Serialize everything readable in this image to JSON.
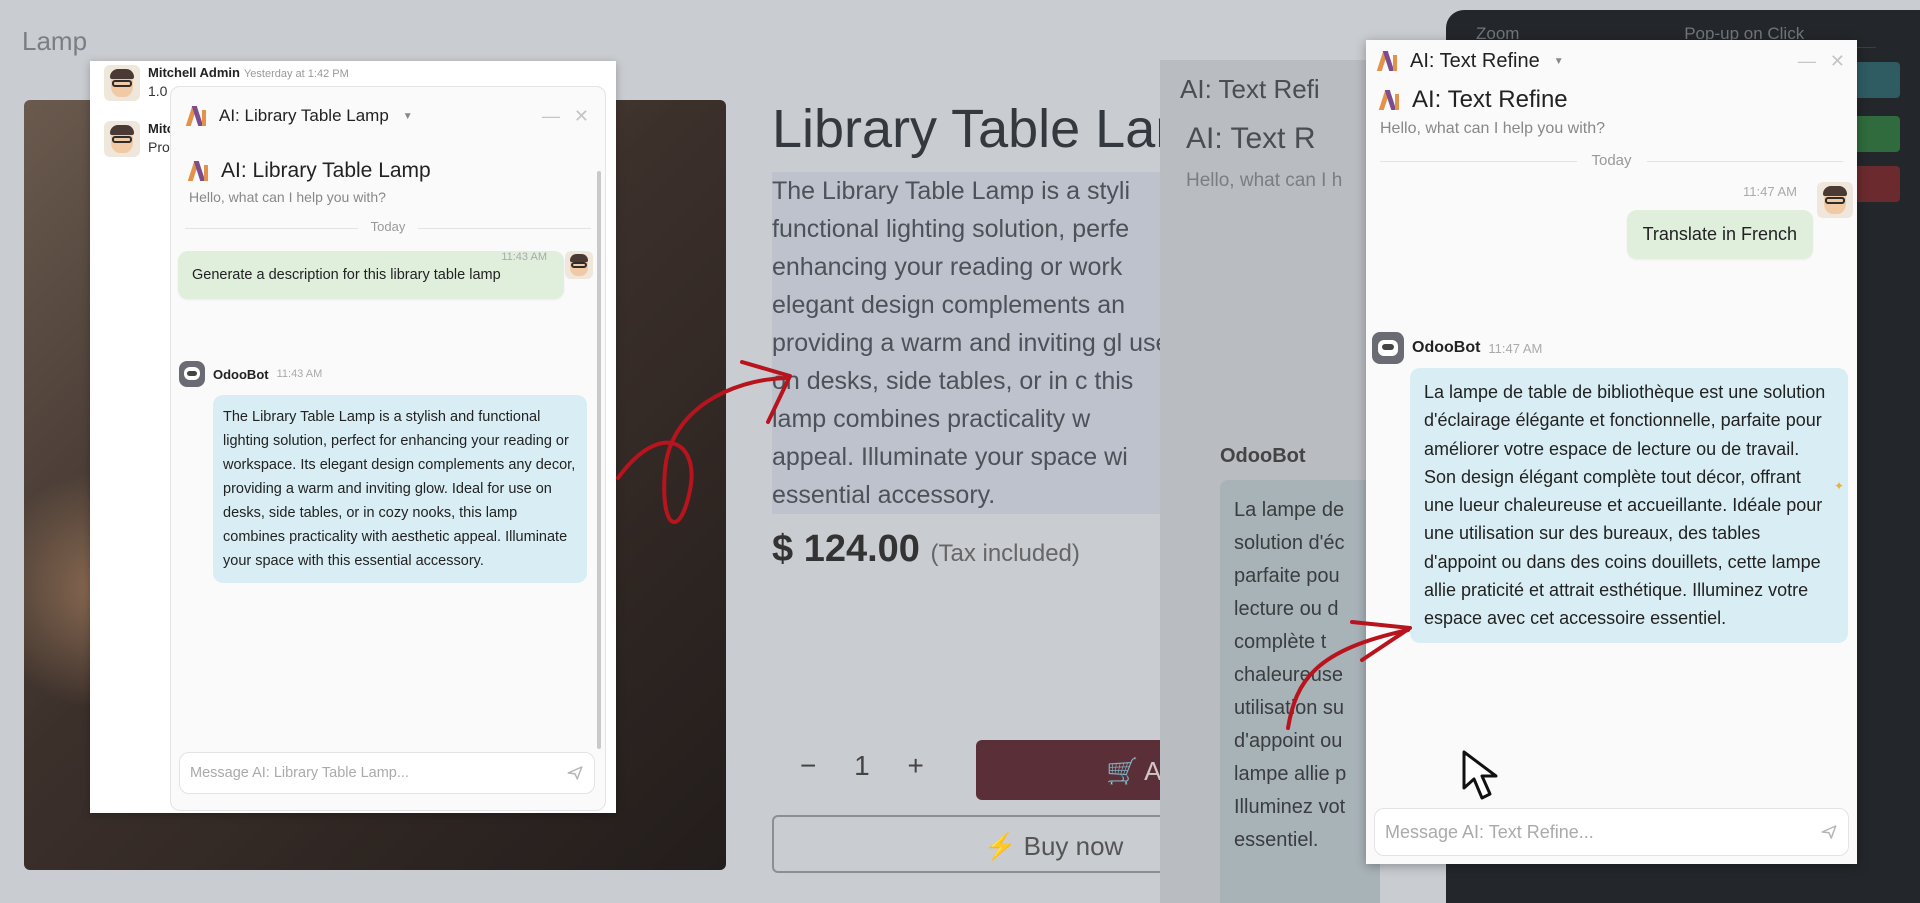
{
  "background": {
    "breadcrumb": "Lamp",
    "product_title": "Library Table Lam",
    "description": "The Library Table Lamp is a styli functional lighting solution, perfe enhancing your reading or work elegant design complements an providing a warm and inviting gl use on desks, side tables, or in c this lamp combines practicality w appeal. Illuminate your space wi essential accessory.",
    "price": "$ 124.00",
    "tax_note": "(Tax included)",
    "qty_minus": "−",
    "qty_value": "1",
    "qty_plus": "+",
    "add_label": "Add",
    "buy_label": "Buy now",
    "ghost_title": "AI: Text Refi",
    "ghost_title2": "AI: Text R",
    "ghost_hello": "Hello, what can I h",
    "ghost_bot": "OdooBot",
    "ghost_bubble": "La lampe de solution d'éc parfaite pou lecture ou d complète t chaleureuse utilisation su d'appoint ou lampe allie p Illuminez vot essentiel.",
    "right_panel": {
      "zoom_label": "Zoom",
      "zoom_value": "Pop-up on Click"
    }
  },
  "chatter": [
    {
      "author": "Mitchell Admin",
      "time": "Yesterday at 1:42 PM",
      "text": "1.0"
    },
    {
      "author": "Mitc",
      "time": "",
      "text": "Pro"
    }
  ],
  "left_chat": {
    "header_title": "AI: Library Table Lamp",
    "intro_title": "AI: Library Table Lamp",
    "hello": "Hello, what can I help you with?",
    "divider": "Today",
    "user_time": "11:43 AM",
    "user_message": "Generate a description for this library table lamp",
    "bot_name": "OdooBot",
    "bot_time": "11:43 AM",
    "bot_message": "The Library Table Lamp is a stylish and functional lighting solution, perfect for enhancing your reading or workspace. Its elegant design complements any decor, providing a warm and inviting glow. Ideal for use on desks, side tables, or in cozy nooks, this lamp combines practicality with aesthetic appeal. Illuminate your space with this essential accessory.",
    "composer_placeholder": "Message AI: Library Table Lamp..."
  },
  "right_chat": {
    "header_title": "AI: Text Refine",
    "intro_title": "AI: Text Refine",
    "hello": "Hello, what can I help you with?",
    "divider": "Today",
    "user_time": "11:47 AM",
    "user_message": "Translate in French",
    "bot_name": "OdooBot",
    "bot_time": "11:47 AM",
    "bot_message": "La lampe de table de bibliothèque est une solution d'éclairage élégante et fonctionnelle, parfaite pour améliorer votre espace de lecture ou de travail. Son design élégant complète tout décor, offrant une lueur chaleureuse et accueillante. Idéale pour une utilisation sur des bureaux, des tables d'appoint ou dans des coins douillets, cette lampe allie praticité et attrait esthétique. Illuminez votre espace avec cet accessoire essentiel.",
    "composer_placeholder": "Message AI: Text Refine..."
  },
  "icons": {
    "ai_logo": "ai-logo-icon",
    "minimize": "minimize-icon",
    "close": "close-icon",
    "send": "send-icon",
    "sparkle": "sparkle-icon",
    "cursor": "mouse-cursor-icon",
    "cart": "cart-icon",
    "lightning": "lightning-icon"
  },
  "colors": {
    "user_bubble": "#dfefdc",
    "bot_bubble": "#d9eef4",
    "annotation_red": "#b8141e",
    "ai_logo_orange": "#e4914a",
    "ai_logo_purple": "#7b4d8f"
  }
}
